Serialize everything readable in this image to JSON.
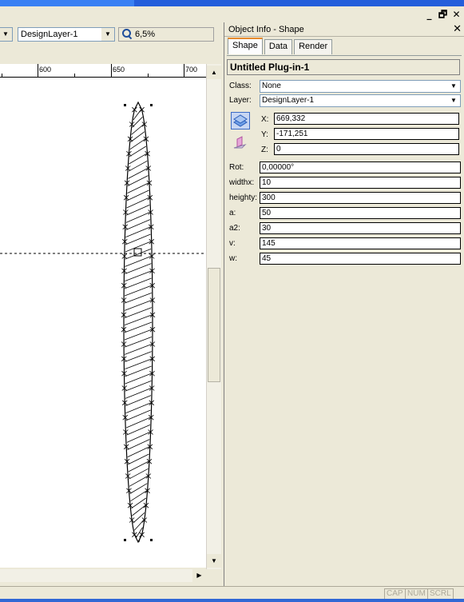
{
  "window": {
    "controls": {
      "minimize": "_",
      "restore": "🗗",
      "close": "✕"
    }
  },
  "toolbar": {
    "layer_value": "DesignLayer-1",
    "zoom_value": "6,5%"
  },
  "ruler": {
    "labels": [
      "600",
      "650",
      "700"
    ]
  },
  "panel": {
    "title": "Object Info - Shape",
    "close": "✕",
    "tabs": [
      {
        "label": "Shape",
        "active": true
      },
      {
        "label": "Data",
        "active": false
      },
      {
        "label": "Render",
        "active": false
      }
    ],
    "object_name": "Untitled Plug-in-1",
    "class": {
      "label": "Class:",
      "value": "None"
    },
    "layer": {
      "label": "Layer:",
      "value": "DesignLayer-1"
    },
    "coords": {
      "x_label": "X:",
      "x_value": "669,332",
      "y_label": "Y:",
      "y_value": "-171,251",
      "z_label": "Z:",
      "z_value": "0"
    },
    "params": [
      {
        "label": "Rot:",
        "value": "0,00000°"
      },
      {
        "label": "widthx:",
        "value": "10"
      },
      {
        "label": "heighty:",
        "value": "300"
      },
      {
        "label": "a:",
        "value": "50"
      },
      {
        "label": "a2:",
        "value": "30"
      },
      {
        "label": "v:",
        "value": "145"
      },
      {
        "label": "w:",
        "value": "45"
      }
    ],
    "icons": [
      "layer-plane-icon",
      "screen-plane-icon"
    ]
  },
  "status": {
    "indicators": [
      "CAP",
      "NUM",
      "SCRL"
    ]
  },
  "colors": {
    "panel_bg": "#ece9d8",
    "tab_active_accent": "#e68b2c",
    "titlebar_blue": "#245edb"
  }
}
